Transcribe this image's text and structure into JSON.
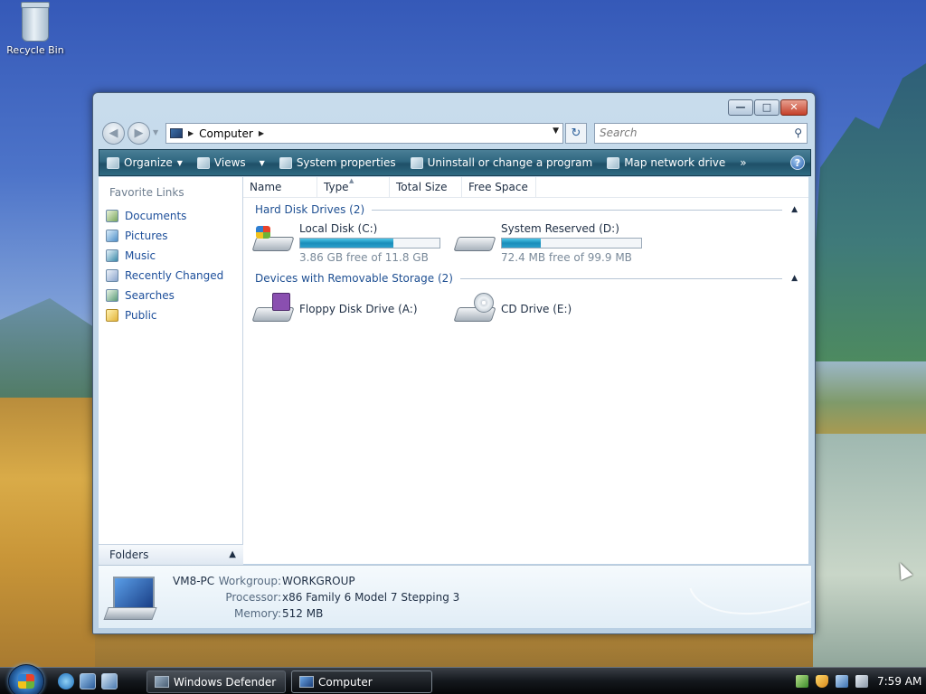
{
  "desktop": {
    "recycle_bin_label": "Recycle Bin"
  },
  "window": {
    "address": {
      "location": "Computer",
      "search_placeholder": "Search"
    },
    "command_bar": {
      "organize": "Organize",
      "views": "Views",
      "system_properties": "System properties",
      "uninstall": "Uninstall or change a program",
      "map_drive": "Map network drive",
      "more": "»"
    },
    "sidebar": {
      "title": "Favorite Links",
      "items": [
        {
          "label": "Documents",
          "icon": "documents-icon"
        },
        {
          "label": "Pictures",
          "icon": "pictures-icon"
        },
        {
          "label": "Music",
          "icon": "music-icon"
        },
        {
          "label": "Recently Changed",
          "icon": "recently-changed-icon"
        },
        {
          "label": "Searches",
          "icon": "searches-icon"
        },
        {
          "label": "Public",
          "icon": "public-folder-icon"
        }
      ],
      "folders_label": "Folders"
    },
    "columns": [
      "Name",
      "Type",
      "Total Size",
      "Free Space"
    ],
    "groups": {
      "hard_disks": {
        "title": "Hard Disk Drives (2)",
        "drives": [
          {
            "name": "Local Disk (C:)",
            "free_text": "3.86 GB free of 11.8 GB",
            "used_fraction": 0.67
          },
          {
            "name": "System Reserved (D:)",
            "free_text": "72.4 MB free of 99.9 MB",
            "used_fraction": 0.28
          }
        ]
      },
      "removable": {
        "title": "Devices with Removable Storage (2)",
        "drives": [
          {
            "name": "Floppy Disk Drive (A:)"
          },
          {
            "name": "CD Drive (E:)"
          }
        ]
      }
    },
    "details": {
      "computer_name": "VM8-PC",
      "workgroup_label": "Workgroup:",
      "workgroup": "WORKGROUP",
      "processor_label": "Processor:",
      "processor": "x86 Family 6 Model 7 Stepping 3",
      "memory_label": "Memory:",
      "memory": "512 MB"
    }
  },
  "taskbar": {
    "tasks": [
      {
        "label": "Windows Defender",
        "active": false
      },
      {
        "label": "Computer",
        "active": true
      }
    ],
    "clock": "7:59 AM"
  }
}
